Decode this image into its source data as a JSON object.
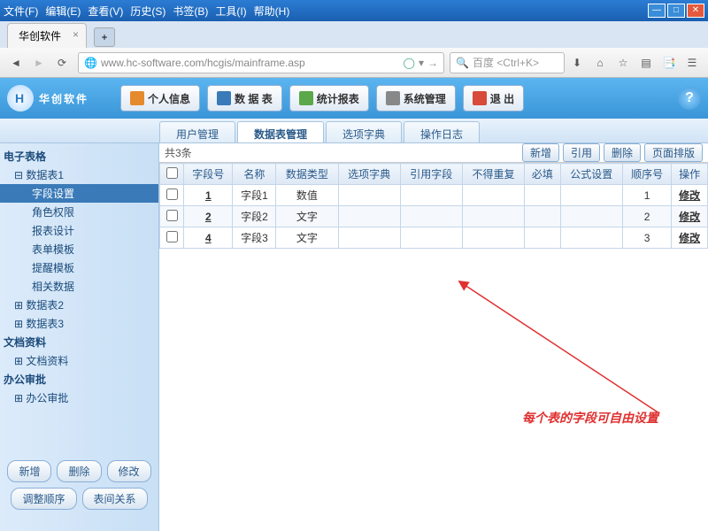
{
  "menubar": [
    "文件(F)",
    "编辑(E)",
    "查看(V)",
    "历史(S)",
    "书签(B)",
    "工具(I)",
    "帮助(H)"
  ],
  "tab_title": "华创软件",
  "url": "www.hc-software.com/hcgis/mainframe.asp",
  "search_placeholder": "百度 <Ctrl+K>",
  "logo_text": "华创软件",
  "logo_badge": "H",
  "header_btns": [
    {
      "label": "个人信息",
      "color": "#e68a2e"
    },
    {
      "label": "数 据 表",
      "color": "#3a7ab8"
    },
    {
      "label": "统计报表",
      "color": "#5aa84a"
    },
    {
      "label": "系统管理",
      "color": "#888"
    },
    {
      "label": "退  出",
      "color": "#d84a3a"
    }
  ],
  "subnav": [
    "用户管理",
    "数据表管理",
    "选项字典",
    "操作日志"
  ],
  "subnav_active": 1,
  "tree": [
    {
      "t": "电子表格",
      "lvl": "bold"
    },
    {
      "t": "数据表1",
      "lvl": "lvl1",
      "exp": "⊟"
    },
    {
      "t": "字段设置",
      "lvl": "lvl2",
      "sel": true
    },
    {
      "t": "角色权限",
      "lvl": "lvl2"
    },
    {
      "t": "报表设计",
      "lvl": "lvl2"
    },
    {
      "t": "表单模板",
      "lvl": "lvl2"
    },
    {
      "t": "提醒模板",
      "lvl": "lvl2"
    },
    {
      "t": "相关数据",
      "lvl": "lvl2"
    },
    {
      "t": "数据表2",
      "lvl": "lvl1",
      "exp": "⊞"
    },
    {
      "t": "数据表3",
      "lvl": "lvl1",
      "exp": "⊞"
    },
    {
      "t": "文档资料",
      "lvl": "bold"
    },
    {
      "t": "文档资料",
      "lvl": "lvl1",
      "exp": "⊞"
    },
    {
      "t": "办公审批",
      "lvl": "bold"
    },
    {
      "t": "办公审批",
      "lvl": "lvl1",
      "exp": "⊞"
    }
  ],
  "side_btns": [
    "新增",
    "删除",
    "修改",
    "调整顺序",
    "表间关系"
  ],
  "count_text": "共3条",
  "content_btns": [
    "新增",
    "引用",
    "删除",
    "页面排版"
  ],
  "cols": [
    "",
    "字段号",
    "名称",
    "数据类型",
    "选项字典",
    "引用字段",
    "不得重复",
    "必填",
    "公式设置",
    "顺序号",
    "操作"
  ],
  "rows": [
    {
      "n": "1",
      "name": "字段1",
      "type": "数值",
      "seq": "1",
      "op": "修改"
    },
    {
      "n": "2",
      "name": "字段2",
      "type": "文字",
      "seq": "2",
      "op": "修改"
    },
    {
      "n": "4",
      "name": "字段3",
      "type": "文字",
      "seq": "3",
      "op": "修改"
    }
  ],
  "annotation": "每个表的字段可自由设置"
}
